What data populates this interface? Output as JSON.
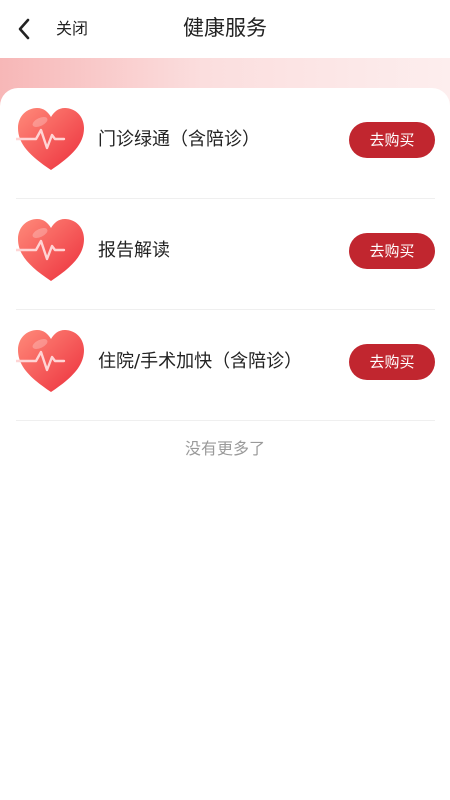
{
  "header": {
    "back_icon": "chevron-left-icon",
    "close_label": "关闭",
    "title": "健康服务"
  },
  "theme": {
    "accent": "#c1262f",
    "banner_gradient_start": "#f7b7b7",
    "banner_gradient_end": "#fdeeee",
    "heart_color": "#f0454e"
  },
  "services": [
    {
      "icon": "heart-pulse-icon",
      "name": "门诊绿通（含陪诊）",
      "button_label": "去购买"
    },
    {
      "icon": "heart-pulse-icon",
      "name": "报告解读",
      "button_label": "去购买"
    },
    {
      "icon": "heart-pulse-icon",
      "name": "住院/手术加快（含陪诊）",
      "button_label": "去购买"
    }
  ],
  "footer": {
    "no_more": "没有更多了"
  }
}
